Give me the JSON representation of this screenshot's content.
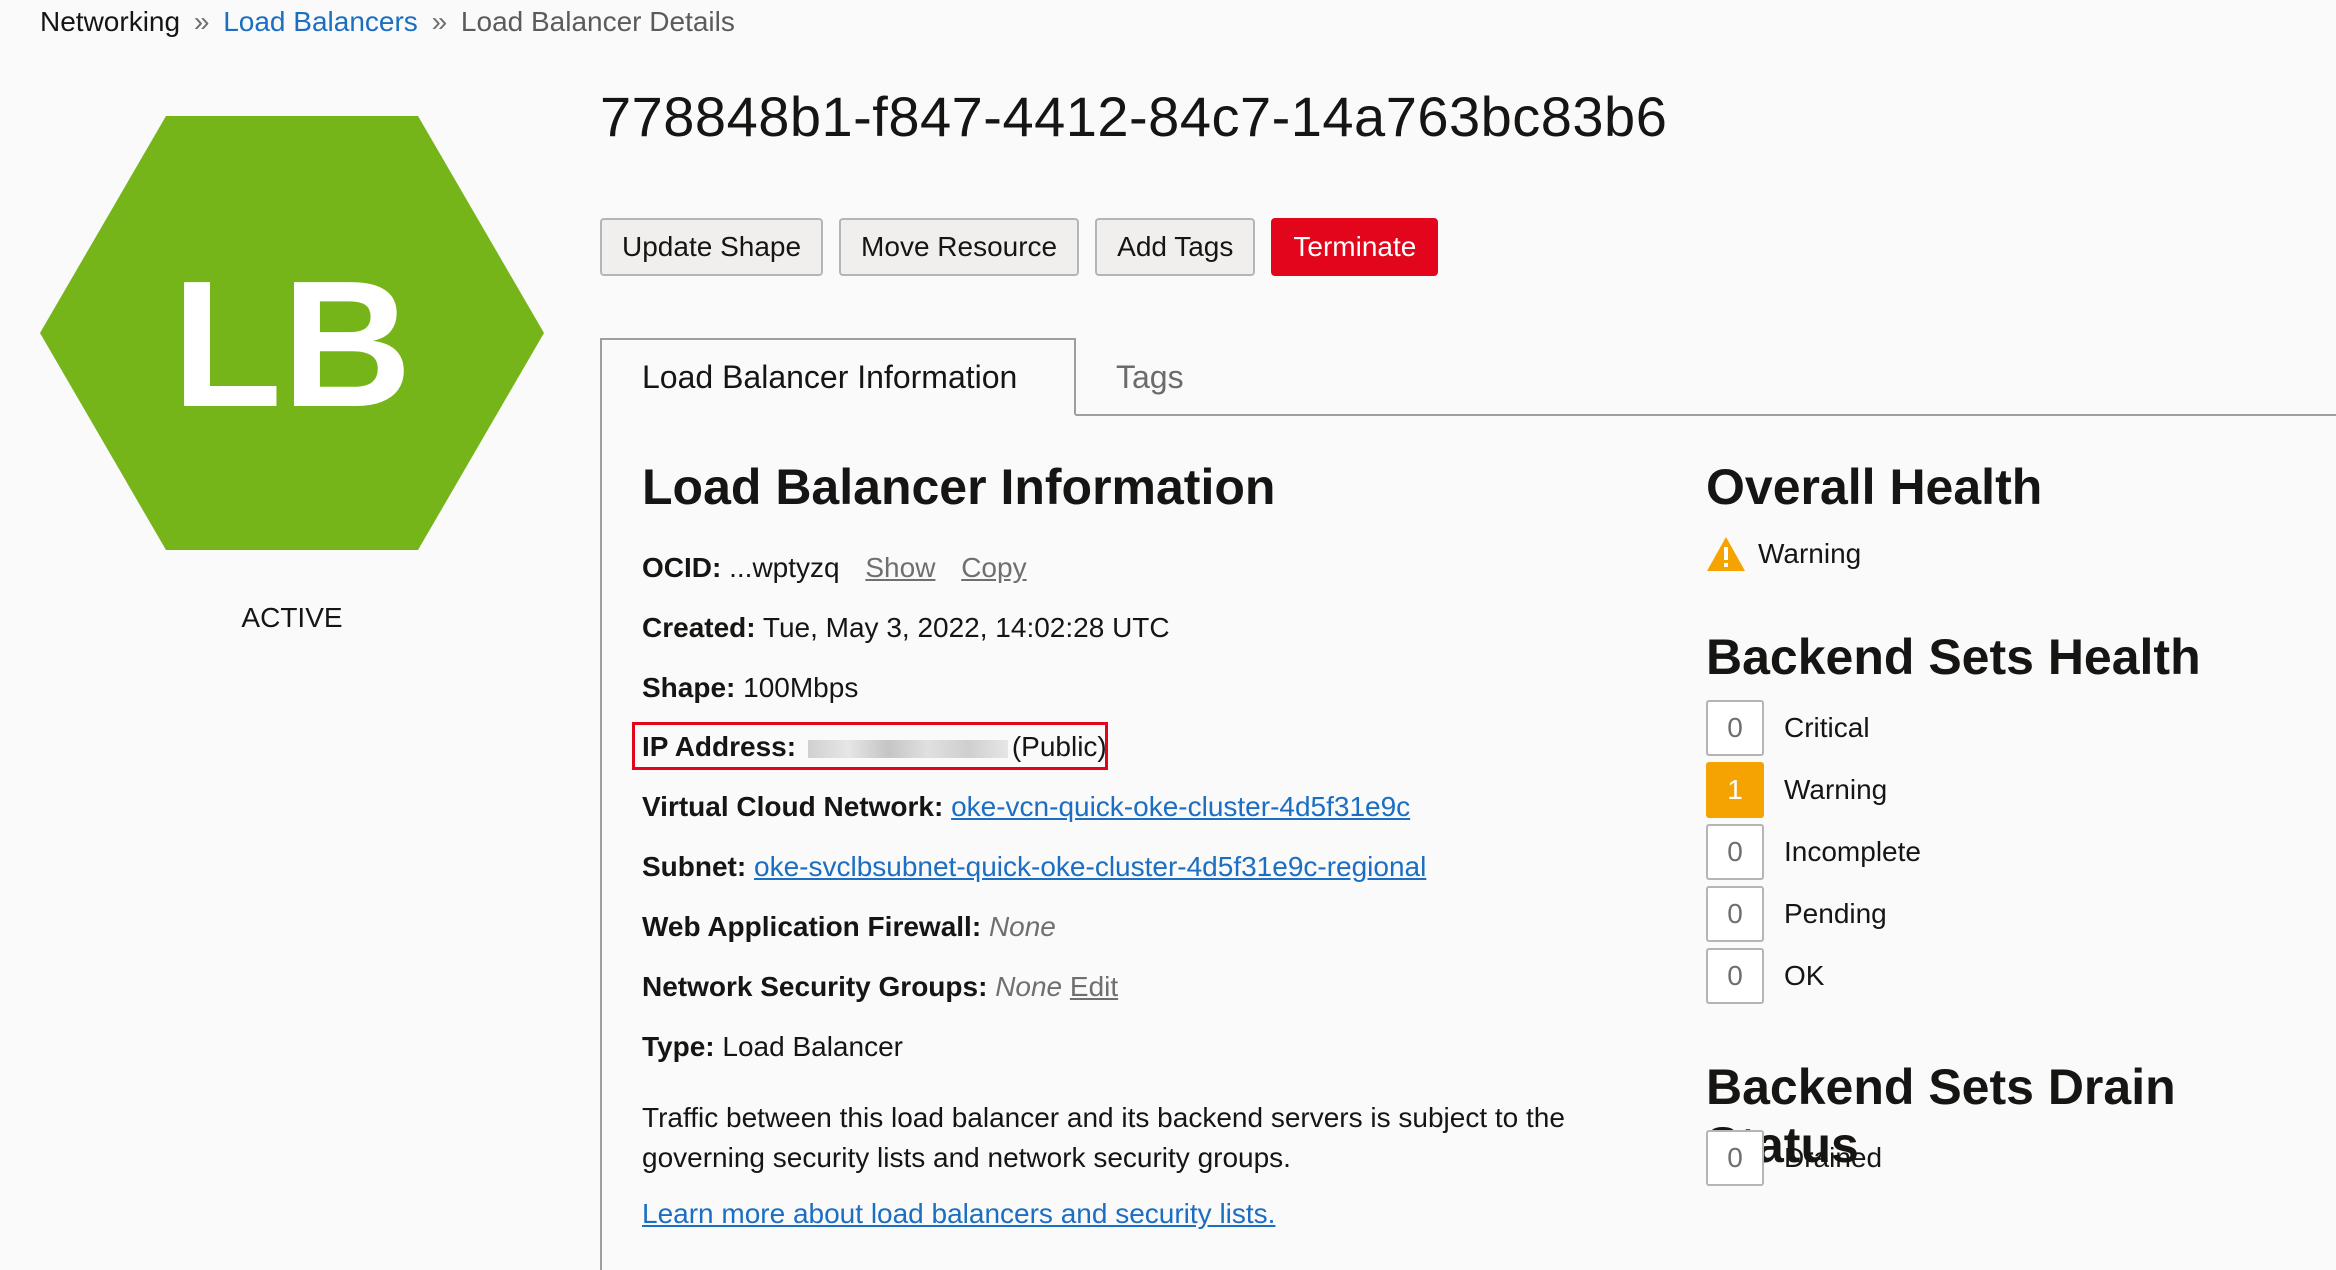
{
  "breadcrumb": {
    "root": "Networking",
    "sep": "»",
    "link": "Load Balancers",
    "current": "Load Balancer Details"
  },
  "icon": {
    "text": "LB",
    "color": "#76b51a",
    "name": "load-balancer-hexagon-icon"
  },
  "state": "ACTIVE",
  "title": "778848b1-f847-4412-84c7-14a763bc83b6",
  "actions": {
    "update_shape": "Update Shape",
    "move_resource": "Move Resource",
    "add_tags": "Add Tags",
    "terminate": "Terminate"
  },
  "tabs": {
    "info": "Load Balancer Information",
    "tags": "Tags"
  },
  "info": {
    "heading": "Load Balancer Information",
    "ocid_label": "OCID:",
    "ocid_value": "...wptyzq",
    "show": "Show",
    "copy": "Copy",
    "created_label": "Created:",
    "created_value": "Tue, May 3, 2022, 14:02:28 UTC",
    "shape_label": "Shape:",
    "shape_value": "100Mbps",
    "ip_label": "IP Address:",
    "ip_suffix": "(Public)",
    "vcn_label": "Virtual Cloud Network:",
    "vcn_value": "oke-vcn-quick-oke-cluster-4d5f31e9c",
    "subnet_label": "Subnet:",
    "subnet_value": "oke-svclbsubnet-quick-oke-cluster-4d5f31e9c-regional",
    "waf_label": "Web Application Firewall:",
    "waf_value": "None",
    "nsg_label": "Network Security Groups:",
    "nsg_value": "None",
    "nsg_edit": "Edit",
    "type_label": "Type:",
    "type_value": "Load Balancer",
    "note": "Traffic between this load balancer and its backend servers is subject to the governing security lists and network security groups.",
    "learn_more": "Learn more about load balancers and security lists."
  },
  "overall_health": {
    "heading": "Overall Health",
    "status": "Warning"
  },
  "backend_health": {
    "heading": "Backend Sets Health",
    "rows": [
      {
        "count": "0",
        "label": "Critical"
      },
      {
        "count": "1",
        "label": "Warning"
      },
      {
        "count": "0",
        "label": "Incomplete"
      },
      {
        "count": "0",
        "label": "Pending"
      },
      {
        "count": "0",
        "label": "OK"
      }
    ]
  },
  "drain_status": {
    "heading": "Backend Sets Drain Status",
    "count": "0",
    "label": "Drained"
  },
  "colors": {
    "accent_link": "#1b6ec2",
    "danger": "#e3051b",
    "warning": "#f5a300",
    "lb_green": "#76b51a"
  }
}
